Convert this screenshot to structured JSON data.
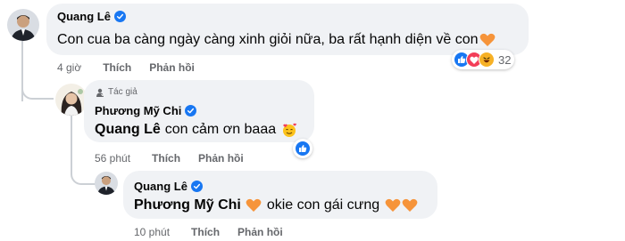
{
  "comments": [
    {
      "author": "Quang Lê",
      "text": "Con cua ba càng ngày càng xinh giỏi nữa, ba rất hạnh diện về con",
      "time": "4 giờ",
      "like": "Thích",
      "reply": "Phản hồi",
      "reaction_count": "32"
    },
    {
      "badge": "Tác giả",
      "author": "Phương Mỹ Chi",
      "mention": "Quang Lê",
      "text": "con cảm ơn baaa",
      "time": "56 phút",
      "like": "Thích",
      "reply": "Phản hồi"
    },
    {
      "author": "Quang Lê",
      "mention": "Phương Mỹ Chi",
      "text": "okie con gái cưng",
      "time": "10 phút",
      "like": "Thích",
      "reply": "Phản hồi"
    }
  ],
  "colors": {
    "facebook_blue": "#1877f2",
    "bubble_bg": "#f0f2f5",
    "meta_text": "#65676b",
    "heart_orange": "#f6943a"
  },
  "icons": [
    "verified-badge-icon",
    "orange-heart-icon",
    "like-reaction-icon",
    "love-reaction-icon",
    "haha-reaction-icon",
    "smiling-hearts-emoji-icon",
    "author-badge-icon"
  ]
}
